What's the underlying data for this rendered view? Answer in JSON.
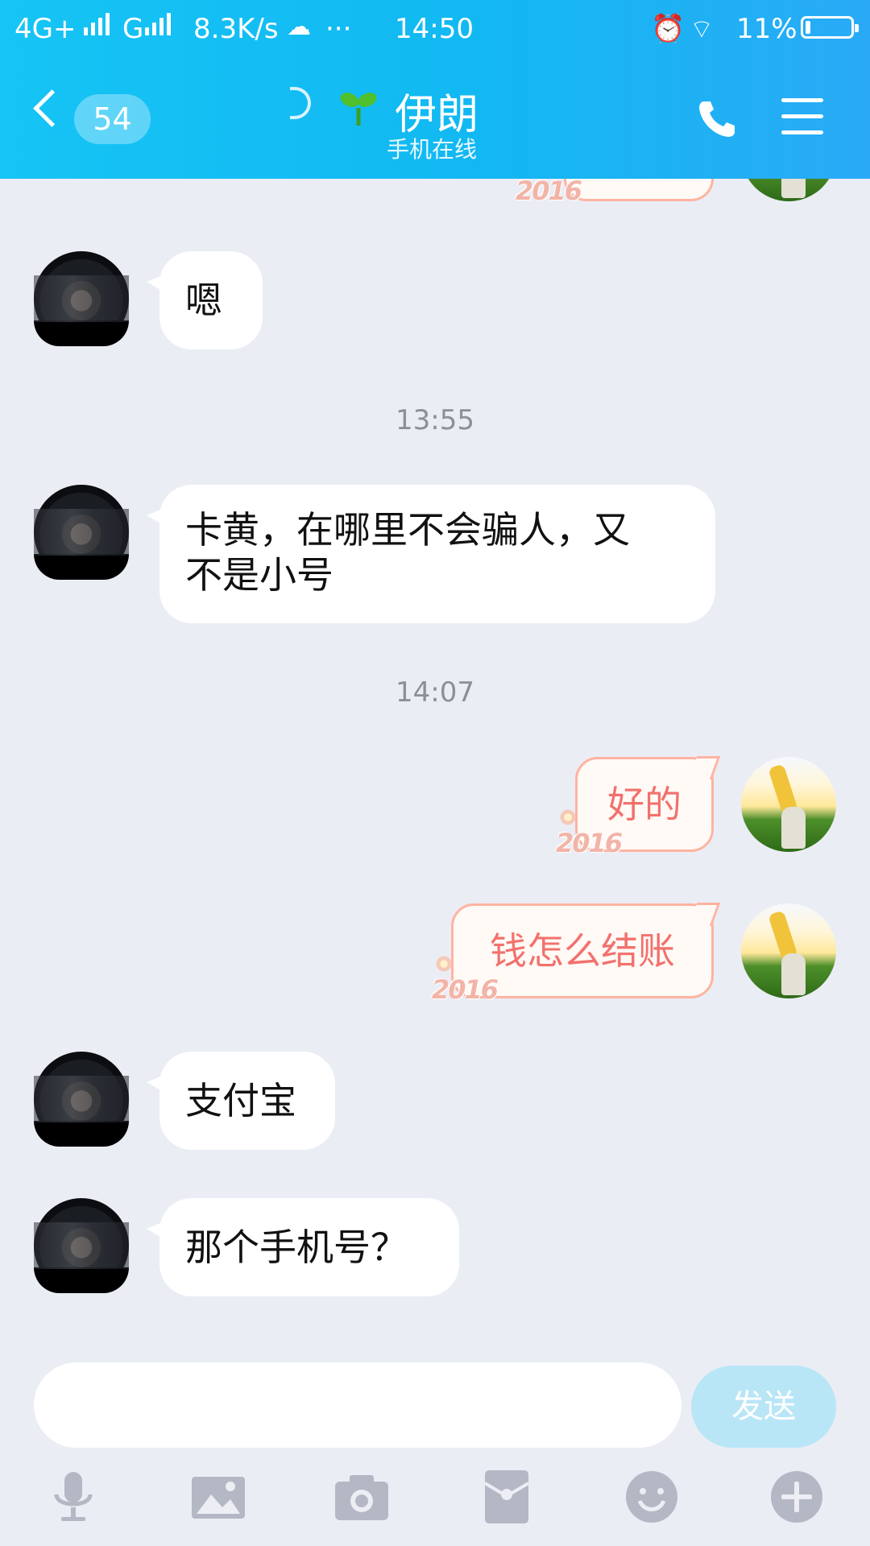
{
  "status_bar": {
    "network": "4G+",
    "network2": "G",
    "speed": "8.3K/s",
    "more": "···",
    "time": "14:50",
    "battery": "11%"
  },
  "header": {
    "unread_count": "54",
    "contact_name": "伊朗",
    "contact_status": "手机在线"
  },
  "messages": [
    {
      "side": "left",
      "text": "嗯"
    },
    {
      "type": "time",
      "text": "13:55"
    },
    {
      "side": "left",
      "text_line1": "卡黄，在哪里不会骗人，又",
      "text_line2": "不是小号"
    },
    {
      "type": "time",
      "text": "14:07"
    },
    {
      "side": "right",
      "text": "好的",
      "badge": "2016"
    },
    {
      "side": "right",
      "text": "钱怎么结账",
      "badge": "2016"
    },
    {
      "side": "left",
      "text": "支付宝"
    },
    {
      "side": "left",
      "text": "那个手机号？"
    }
  ],
  "partial_badge": "2016",
  "input": {
    "value": "",
    "send_label": "发送"
  },
  "toolbar": [
    "microphone-icon",
    "image-icon",
    "camera-icon",
    "red-packet-icon",
    "emoji-icon",
    "plus-icon"
  ],
  "colors": {
    "header": "#12b8f2",
    "bubble_right_text": "#f2716d",
    "bubble_right_border": "#ffb3a1",
    "background": "#ebedf5",
    "send_button": "#b9e6f7"
  }
}
